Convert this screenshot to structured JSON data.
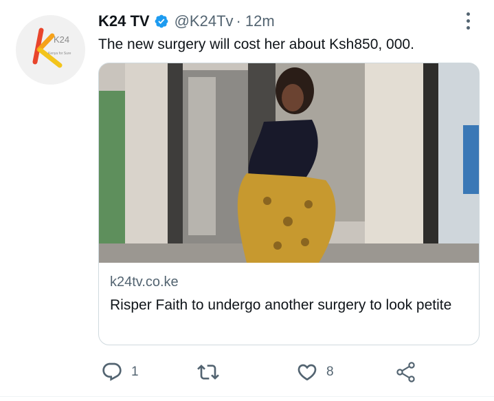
{
  "author": {
    "name": "K24 TV",
    "handle": "@K24Tv",
    "separator": "·",
    "time": "12m",
    "avatar_text": "K24",
    "avatar_subtext": "Kenya for Sure"
  },
  "tweet": {
    "text": "The new surgery will cost her about Ksh850, 000."
  },
  "card": {
    "domain": "k24tv.co.ke",
    "title": "Risper Faith to undergo another surgery to look petite"
  },
  "actions": {
    "reply_count": "1",
    "retweet_count": "",
    "like_count": "8"
  },
  "colors": {
    "text": "#0f1419",
    "secondary": "#536471",
    "verified": "#1d9bf0",
    "border": "#cfd9de"
  },
  "icons": {
    "verified": "verified-badge-icon",
    "more": "more-dots-icon",
    "reply": "reply-icon",
    "retweet": "retweet-icon",
    "like": "heart-icon",
    "share": "share-icon"
  }
}
